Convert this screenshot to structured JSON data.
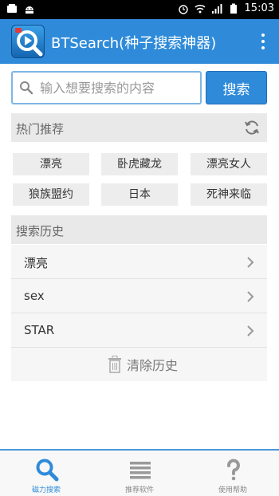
{
  "status_bar": {
    "time": "15:03",
    "icons": [
      "notification-icon",
      "android-icon",
      "alarm-icon",
      "wifi-icon",
      "signal-icon",
      "battery-icon"
    ]
  },
  "app_bar": {
    "title": "BTSearch(种子搜索神器)",
    "icons": [
      "app-logo-icon",
      "overflow-menu-icon"
    ]
  },
  "search": {
    "placeholder": "输入想要搜索的内容",
    "value": "",
    "button_label": "搜索"
  },
  "hot": {
    "title": "热门推荐",
    "tags": [
      "漂亮",
      "卧虎藏龙",
      "漂亮女人",
      "狼族盟约",
      "日本",
      "死神来临"
    ]
  },
  "history": {
    "title": "搜索历史",
    "items": [
      "漂亮",
      "sex",
      "STAR"
    ],
    "clear_label": "清除历史"
  },
  "bottom_nav": {
    "tabs": [
      {
        "label": "磁力搜索",
        "icon": "search-icon",
        "active": true
      },
      {
        "label": "推荐软件",
        "icon": "list-icon",
        "active": false
      },
      {
        "label": "使用帮助",
        "icon": "help-icon",
        "active": false
      }
    ]
  },
  "colors": {
    "primary": "#2f8bd9",
    "section_bg": "#e9e9e9",
    "tag_bg": "#ededed",
    "row_bg": "#f6f6f6",
    "status_bar": "#000000"
  }
}
